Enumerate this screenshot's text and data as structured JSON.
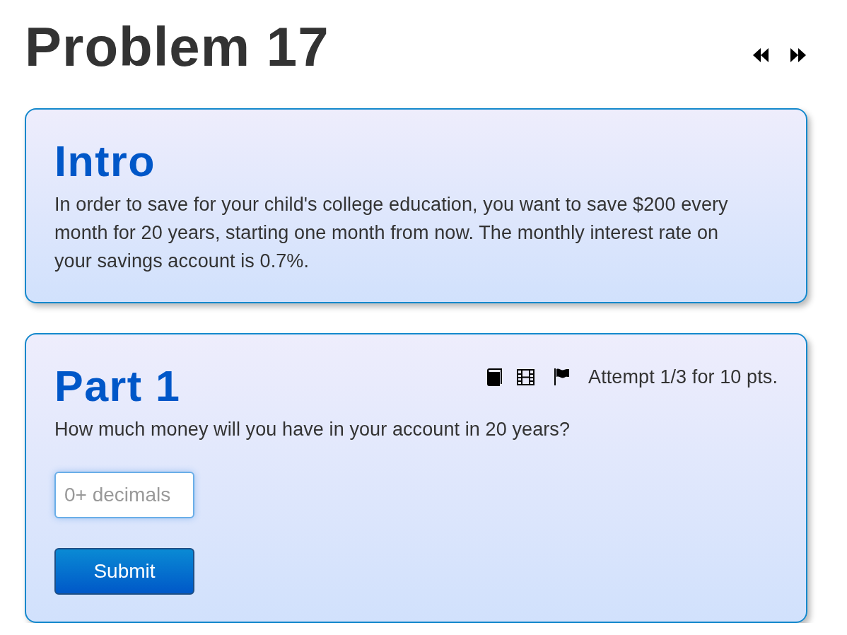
{
  "page": {
    "title": "Problem 17"
  },
  "intro": {
    "heading": "Intro",
    "text": "In order to save for your child's college education, you want to save $200 every month for 20 years, starting one month from now. The monthly interest rate on your savings account is 0.7%."
  },
  "parts": [
    {
      "heading": "Part 1",
      "attempt": "Attempt 1/3 for 10 pts.",
      "question": "How much money will you have in your account in 20 years?",
      "answer": {
        "placeholder": "0+ decimals",
        "focused": true
      },
      "submit": "Submit"
    }
  ]
}
